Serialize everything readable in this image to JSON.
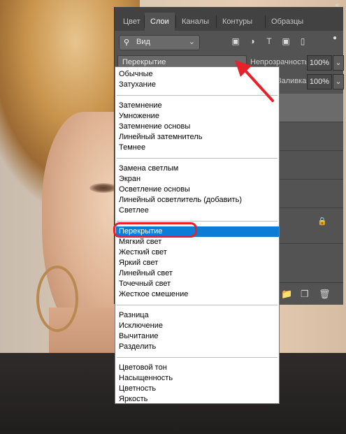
{
  "panel": {
    "tabs": [
      "Цвет",
      "Слои",
      "Каналы",
      "Контуры",
      "Образцы"
    ],
    "active_tab": 1,
    "collapse_label": "«",
    "filter": {
      "label": "Вид",
      "icon": "search-icon"
    },
    "blend_mode": "Перекрытие",
    "opacity_label": "Непрозрачность:",
    "opacity_value": "100%",
    "fill_label": "Заливка:",
    "fill_value": "100%"
  },
  "blend_modes": {
    "groups": [
      [
        "Обычные",
        "Затухание"
      ],
      [
        "Затемнение",
        "Умножение",
        "Затемнение основы",
        "Линейный затемнитель",
        "Темнее"
      ],
      [
        "Замена светлым",
        "Экран",
        "Осветление основы",
        "Линейный осветлитель (добавить)",
        "Светлее"
      ],
      [
        "Перекрытие",
        "Мягкий свет",
        "Жесткий свет",
        "Яркий свет",
        "Линейный свет",
        "Точечный свет",
        "Жесткое смешение"
      ],
      [
        "Разница",
        "Исключение",
        "Вычитание",
        "Разделить"
      ],
      [
        "Цветовой тон",
        "Насыщенность",
        "Цветность",
        "Яркость"
      ]
    ],
    "selected": "Перекрытие"
  },
  "colors": {
    "highlight": "#0b7dd7",
    "annotation": "#e8202a",
    "panel": "#535353"
  }
}
